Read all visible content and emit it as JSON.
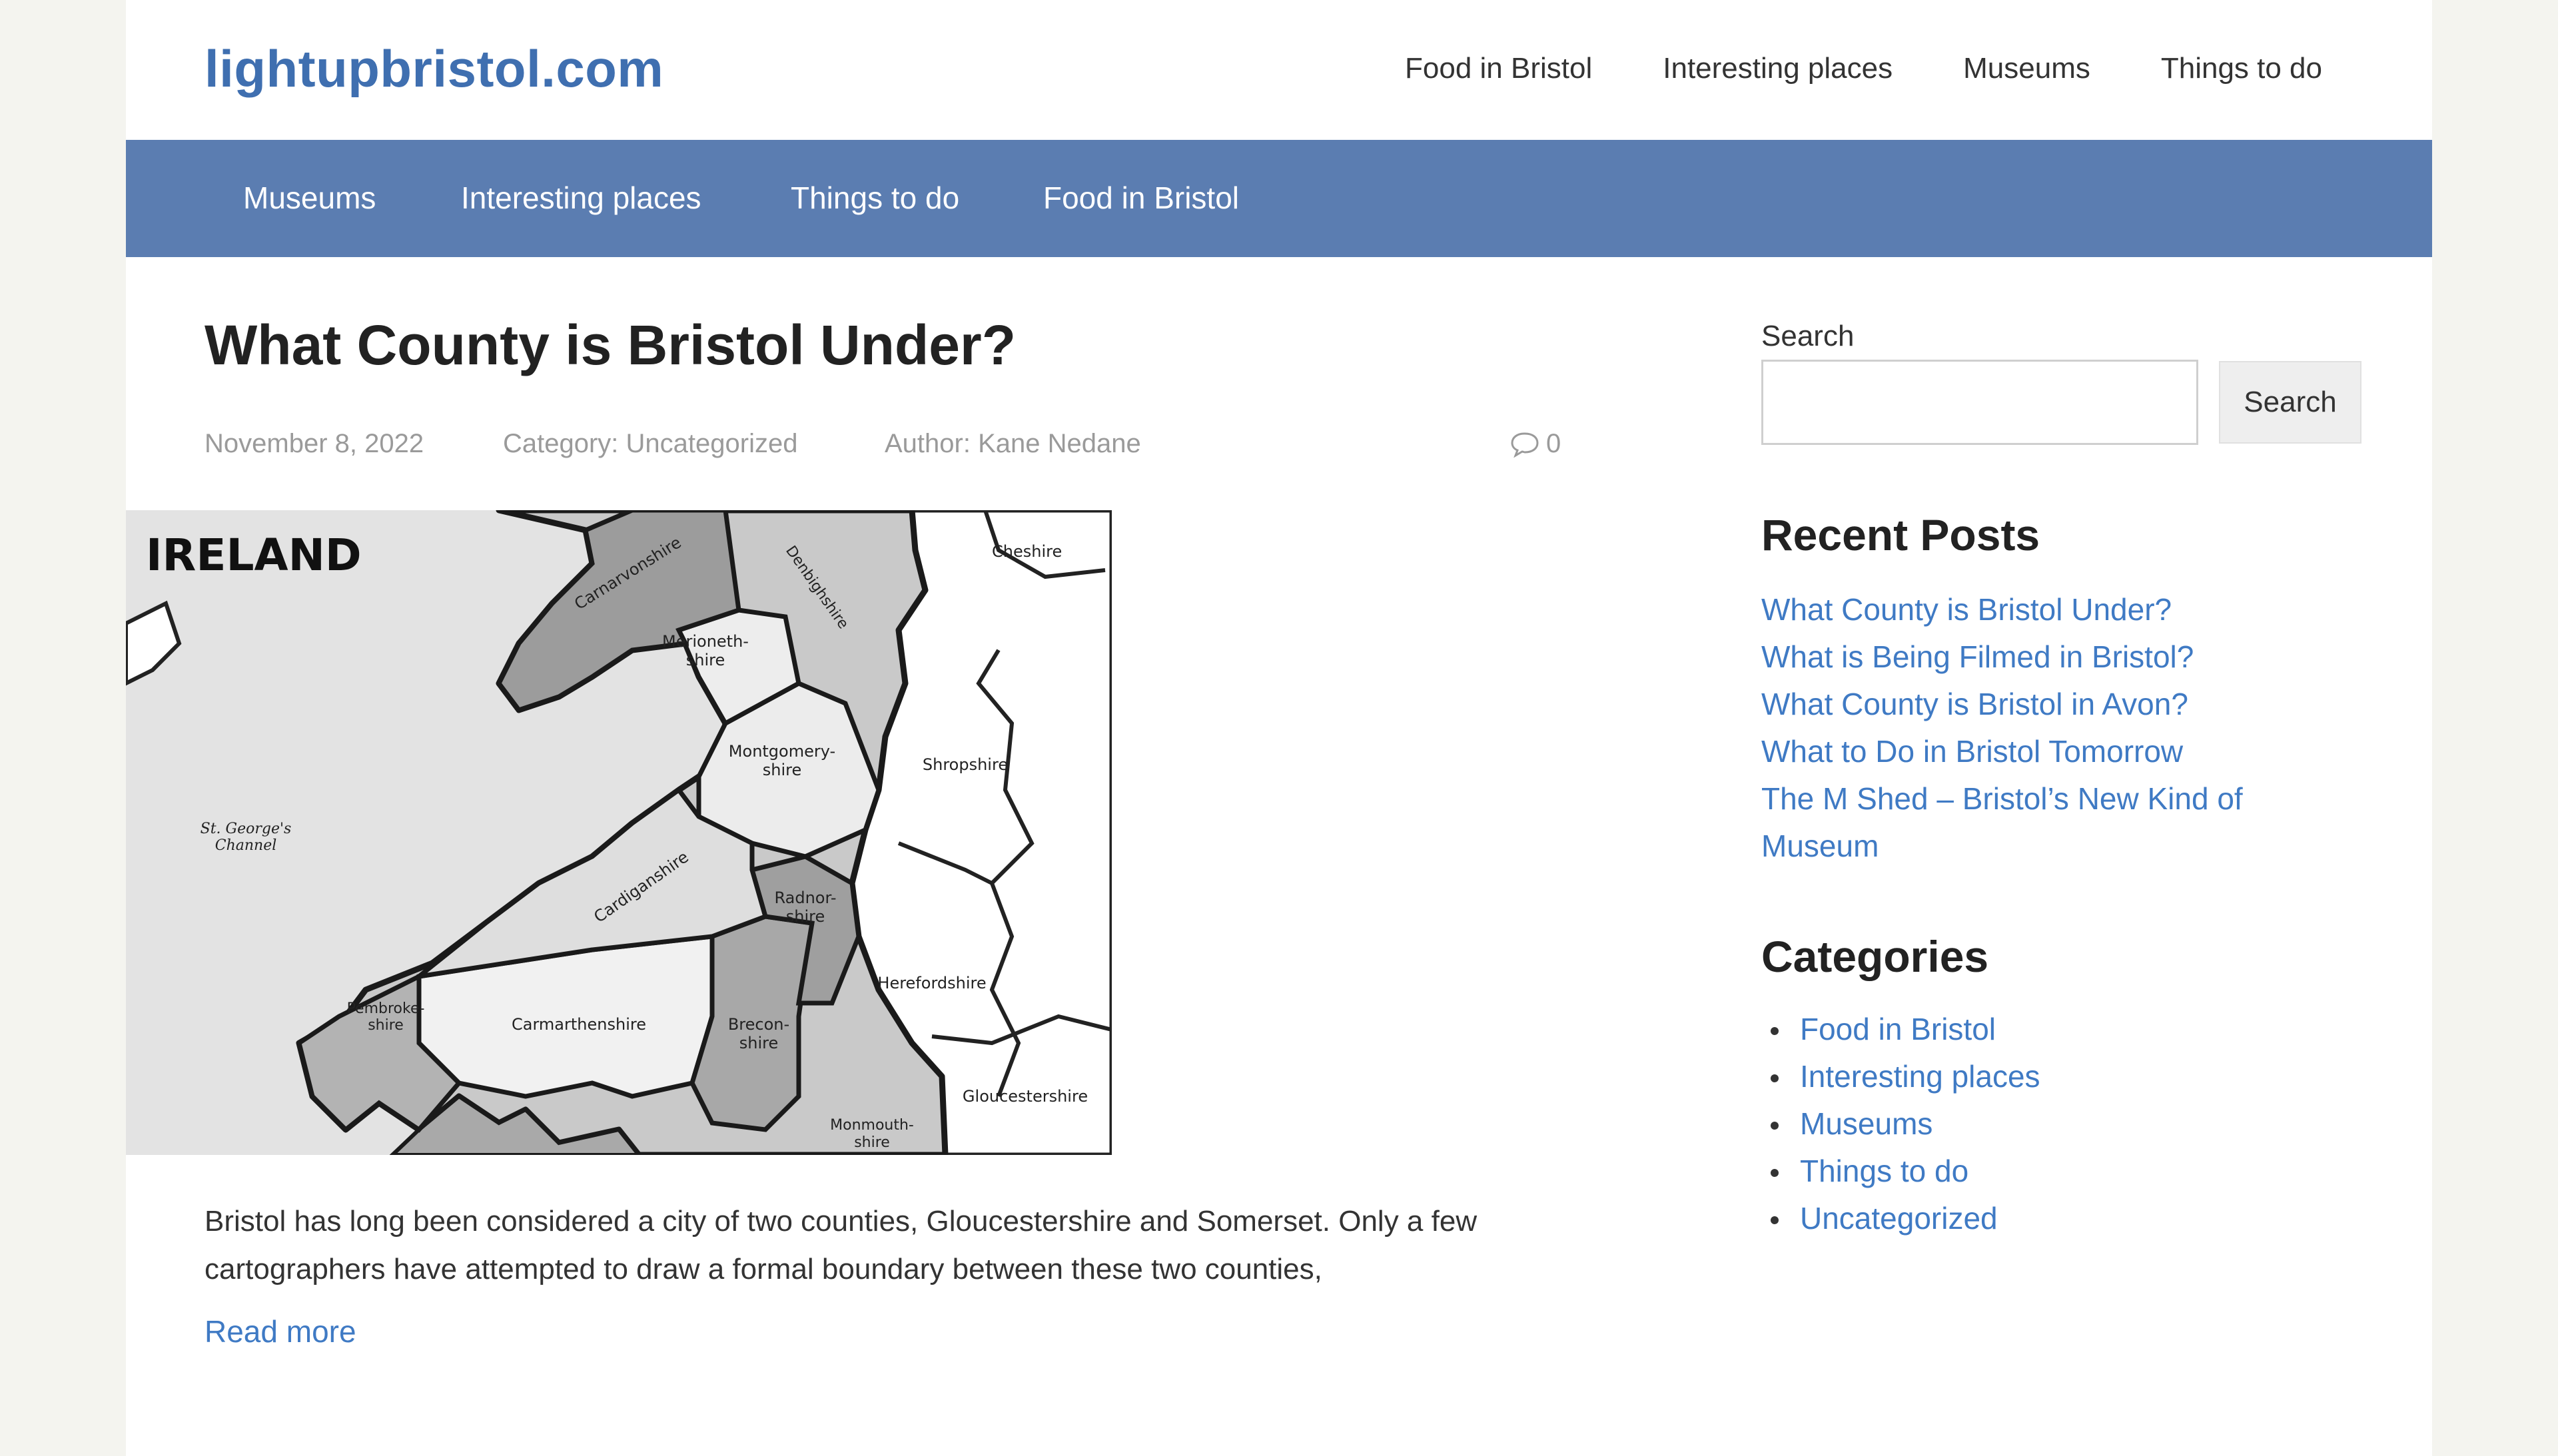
{
  "site": {
    "title": "lightupbristol.com"
  },
  "top_nav": [
    "Food in Bristol",
    "Interesting places",
    "Museums",
    "Things to do"
  ],
  "main_nav": [
    "Museums",
    "Interesting places",
    "Things to do",
    "Food in Bristol"
  ],
  "post": {
    "title": "What County is Bristol Under?",
    "date": "November 8, 2022",
    "category": "Category: Uncategorized",
    "author": "Author: Kane Nedane",
    "comment_count": "0",
    "excerpt_line1": "Bristol has long been considered a city of two counties, Gloucestershire and Somerset. Only a few",
    "excerpt_line2": "cartographers have attempted to draw a formal boundary between these two counties,",
    "read_more": "Read more"
  },
  "map_labels": {
    "ireland": "IRELAND",
    "channel_line1": "St. George's",
    "channel_line2": "Channel",
    "cheshire": "Cheshire",
    "carnarvonshire": "Carnarvonshire",
    "denbighshire": "Denbighshire",
    "merioneth_1": "Merioneth-",
    "merioneth_2": "shire",
    "montgomery_1": "Montgomery-",
    "montgomery_2": "shire",
    "shropshire": "Shropshire",
    "cardiganshire": "Cardiganshire",
    "radnor_1": "Radnor-",
    "radnor_2": "shire",
    "herefordshire": "Herefordshire",
    "pembroke_1": "Pembroke-",
    "pembroke_2": "shire",
    "carmarthenshire": "Carmarthenshire",
    "brecon_1": "Brecon-",
    "brecon_2": "shire",
    "gloucestershire": "Gloucestershire",
    "monmouth_1": "Monmouth-",
    "monmouth_2": "shire"
  },
  "sidebar": {
    "search_label": "Search",
    "search_placeholder": "",
    "search_button": "Search",
    "recent_title": "Recent Posts",
    "recent_posts": [
      "What County is Bristol Under?",
      "What is Being Filmed in Bristol?",
      "What County is Bristol in Avon?",
      "What to Do in Bristol Tomorrow",
      "The M Shed – Bristol’s New Kind of Museum"
    ],
    "categories_title": "Categories",
    "categories": [
      "Food in Bristol",
      "Interesting places",
      "Museums",
      "Things to do",
      "Uncategorized"
    ]
  },
  "colors": {
    "brand": "#3f6fb0",
    "nav_bar": "#5b7db1",
    "link": "#3f7ac4",
    "page_bg": "#f4f4ef"
  }
}
